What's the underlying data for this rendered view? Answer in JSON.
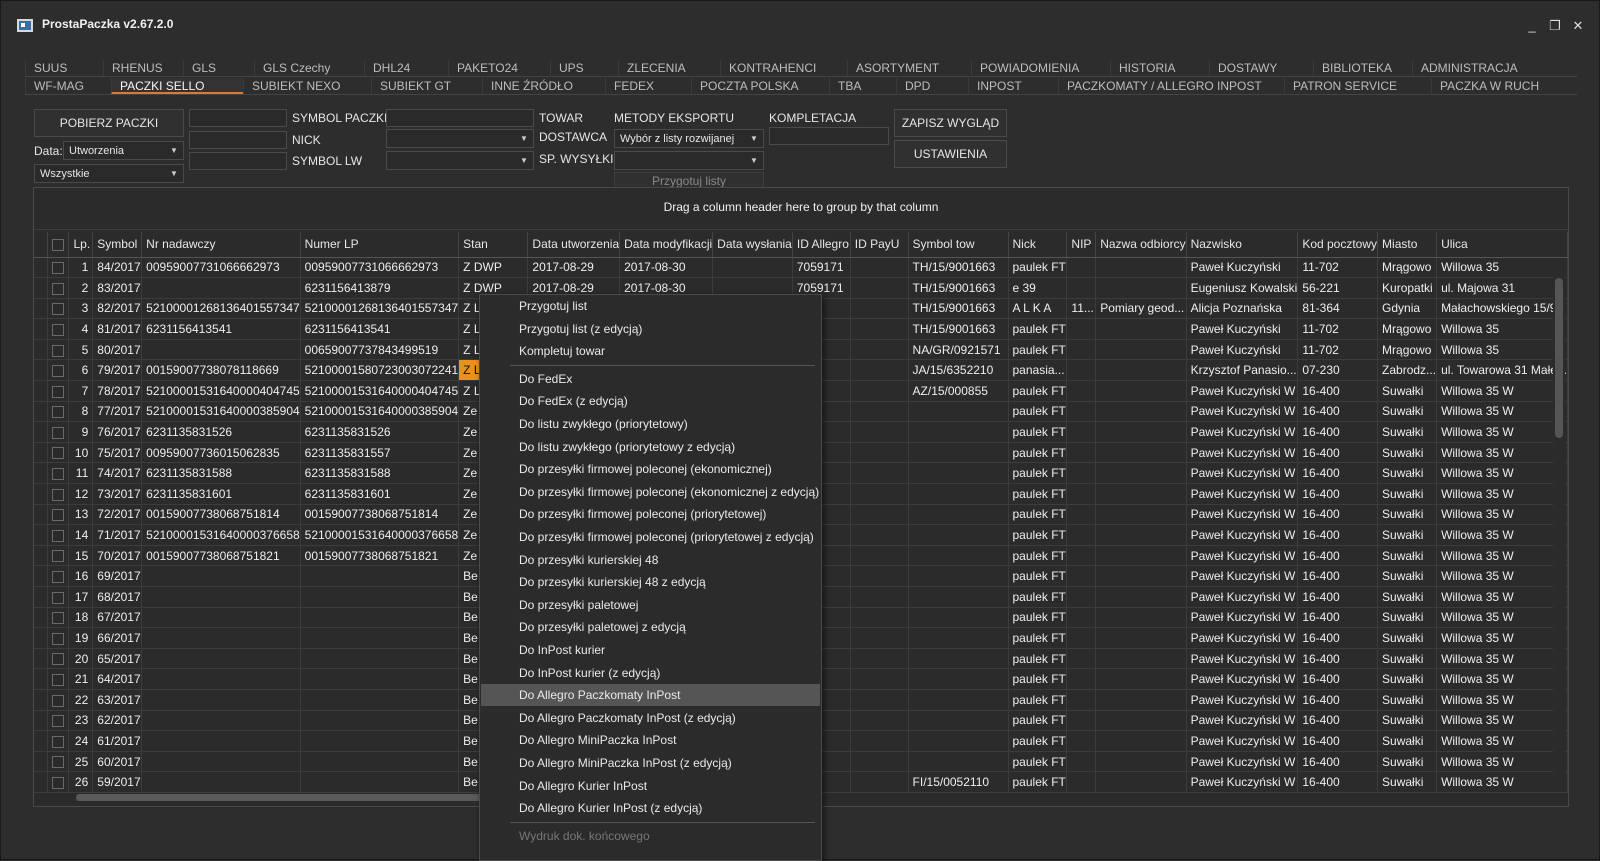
{
  "app": {
    "title": "ProstaPaczka v2.67.2.0",
    "minimize": "_",
    "restore": "❐",
    "close": "✕"
  },
  "tabs_row1": [
    "SUUS",
    "RHENUS",
    "GLS",
    "GLS Czechy",
    "DHL24",
    "PAKETO24",
    "UPS",
    "ZLECENIA",
    "KONTRAHENCI",
    "ASORTYMENT",
    "POWIADOMIENIA",
    "HISTORIA",
    "DOSTAWY",
    "BIBLIOTEKA",
    "ADMINISTRACJA"
  ],
  "tabs_row2": [
    "WF-MAG",
    "PACZKI SELLO",
    "SUBIEKT NEXO",
    "SUBIEKT GT",
    "INNE ŹRÓDŁO",
    "FEDEX",
    "POCZTA POLSKA",
    "TBA",
    "DPD",
    "INPOST",
    "PACZKOMATY / ALLEGRO INPOST",
    "PATRON SERVICE",
    "PACZKA W RUCH"
  ],
  "active_tab2": "PACZKI SELLO",
  "toolbar": {
    "fetch_button": "POBIERZ PACZKI",
    "date_label": "Data:",
    "date_value": "Utworzenia",
    "all_value": "Wszystkie",
    "symbol_label": "SYMBOL PACZKI",
    "nick_label": "NICK",
    "symbol_lw_label": "SYMBOL LW",
    "towar_label": "TOWAR",
    "dostawca_label": "DOSTAWCA",
    "sp_wysylki_label": "SP. WYSYŁKI",
    "export_label": "METODY EKSPORTU",
    "export_value": "Wybór z listy rozwijanej",
    "prepare_lists": "Przygotuj listy",
    "kompletacja_label": "KOMPLETACJA",
    "save_view": "ZAPISZ WYGLĄD",
    "settings": "USTAWIENIA"
  },
  "grid": {
    "group_hint": "Drag a column header here to group by that column",
    "columns": [
      "",
      "",
      "Lp.",
      "Symbol",
      "Nr nadawczy",
      "Numer LP",
      "Stan",
      "Data utworzenia",
      "Data modyfikacji",
      "Data wysłania",
      "ID Allegro",
      "ID PayU",
      "Symbol tow",
      "Nick",
      "NIP",
      "Nazwa odbiorcy",
      "Nazwisko",
      "Kod pocztowy",
      "Miasto",
      "Ulica"
    ],
    "rows": [
      [
        "",
        "",
        "1",
        "84/2017",
        "00959007731066662973",
        "00959007731066662973",
        "Z DWP",
        "2017-08-29",
        "2017-08-30",
        "",
        "7059171",
        "",
        "TH/15/9001663",
        "paulek FT",
        "",
        "",
        "Paweł Kuczyński",
        "11-702",
        "Mrągowo",
        "Willowa 35"
      ],
      [
        "",
        "",
        "2",
        "83/2017",
        "",
        "6231156413879",
        "Z DWP",
        "2017-08-29",
        "2017-08-30",
        "",
        "7059171",
        "",
        "TH/15/9001663",
        "e 39",
        "",
        "",
        "Eugeniusz Kowalski",
        "56-221",
        "Kuropatki",
        "ul. Majowa 31"
      ],
      [
        "",
        "",
        "3",
        "82/2017",
        "52100001268136401557347",
        "52100001268136401557347",
        "Z L",
        "",
        "",
        "",
        "171",
        "",
        "TH/15/9001663",
        "A L K A",
        "11...",
        "Pomiary geod...",
        "Alicja Poznańska",
        "81-364",
        "Gdynia",
        "Małachowskiego 15/98"
      ],
      [
        "",
        "",
        "4",
        "81/2017",
        "6231156413541",
        "6231156413541",
        "Z L",
        "",
        "",
        "",
        "171",
        "",
        "TH/15/9001663",
        "paulek FT",
        "",
        "",
        "Paweł Kuczyński",
        "11-702",
        "Mrągowo",
        "Willowa 35"
      ],
      [
        "",
        "",
        "5",
        "80/2017",
        "",
        "00659007737843499519",
        "Z L",
        "",
        "",
        "",
        "171",
        "",
        "NA/GR/0921571",
        "paulek FT",
        "",
        "",
        "Paweł Kuczyński",
        "11-702",
        "Mrągowo",
        "Willowa 35"
      ],
      [
        "▶",
        "",
        "6",
        "79/2017",
        "00159007738078118669",
        "52100001580723003072241",
        "Z L",
        "",
        "",
        "",
        "171",
        "",
        "JA/15/6352210",
        "panasia...",
        "",
        "",
        "Krzysztof Panasio...",
        "07-230",
        "Zabrodz...",
        "ul. Towarowa 31 Małe..."
      ],
      [
        "",
        "",
        "7",
        "78/2017",
        "52100001531640000404745",
        "52100001531640000404745",
        "Z L",
        "",
        "",
        "",
        "171",
        "",
        "AZ/15/000855",
        "paulek FT",
        "",
        "",
        "Paweł Kuczyński W",
        "16-400",
        "Suwałki",
        "Willowa 35 W"
      ],
      [
        "",
        "",
        "8",
        "77/2017",
        "52100001531640000385904",
        "52100001531640000385904",
        "Ze",
        "",
        "",
        "",
        "171",
        "",
        "",
        "paulek FT",
        "",
        "",
        "Paweł Kuczyński W",
        "16-400",
        "Suwałki",
        "Willowa 35 W"
      ],
      [
        "",
        "",
        "9",
        "76/2017",
        "6231135831526",
        "6231135831526",
        "Ze",
        "",
        "",
        "",
        "171",
        "",
        "",
        "paulek FT",
        "",
        "",
        "Paweł Kuczyński W",
        "16-400",
        "Suwałki",
        "Willowa 35 W"
      ],
      [
        "",
        "",
        "10",
        "75/2017",
        "00959007736015062835",
        "6231135831557",
        "Ze",
        "",
        "",
        "",
        "171",
        "",
        "",
        "paulek FT",
        "",
        "",
        "Paweł Kuczyński W",
        "16-400",
        "Suwałki",
        "Willowa 35 W"
      ],
      [
        "",
        "",
        "11",
        "74/2017",
        "6231135831588",
        "6231135831588",
        "Ze",
        "",
        "",
        "",
        "171",
        "",
        "",
        "paulek FT",
        "",
        "",
        "Paweł Kuczyński W",
        "16-400",
        "Suwałki",
        "Willowa 35 W"
      ],
      [
        "",
        "",
        "12",
        "73/2017",
        "6231135831601",
        "6231135831601",
        "Ze",
        "",
        "",
        "",
        "171",
        "",
        "",
        "paulek FT",
        "",
        "",
        "Paweł Kuczyński W",
        "16-400",
        "Suwałki",
        "Willowa 35 W"
      ],
      [
        "",
        "",
        "13",
        "72/2017",
        "00159007738068751814",
        "00159007738068751814",
        "Ze",
        "",
        "",
        "",
        "171",
        "",
        "",
        "paulek FT",
        "",
        "",
        "Paweł Kuczyński W",
        "16-400",
        "Suwałki",
        "Willowa 35 W"
      ],
      [
        "",
        "",
        "14",
        "71/2017",
        "52100001531640000376658",
        "52100001531640000376658",
        "Ze",
        "",
        "",
        "",
        "171",
        "",
        "",
        "paulek FT",
        "",
        "",
        "Paweł Kuczyński W",
        "16-400",
        "Suwałki",
        "Willowa 35 W"
      ],
      [
        "",
        "",
        "15",
        "70/2017",
        "00159007738068751821",
        "00159007738068751821",
        "Ze",
        "",
        "",
        "",
        "171",
        "",
        "",
        "paulek FT",
        "",
        "",
        "Paweł Kuczyński W",
        "16-400",
        "Suwałki",
        "Willowa 35 W"
      ],
      [
        "",
        "",
        "16",
        "69/2017",
        "",
        "",
        "Be",
        "",
        "",
        "",
        "171",
        "",
        "",
        "paulek FT",
        "",
        "",
        "Paweł Kuczyński W",
        "16-400",
        "Suwałki",
        "Willowa 35 W"
      ],
      [
        "",
        "",
        "17",
        "68/2017",
        "",
        "",
        "Be",
        "",
        "",
        "",
        "171",
        "",
        "",
        "paulek FT",
        "",
        "",
        "Paweł Kuczyński W",
        "16-400",
        "Suwałki",
        "Willowa 35 W"
      ],
      [
        "",
        "",
        "18",
        "67/2017",
        "",
        "",
        "Be",
        "",
        "",
        "",
        "171",
        "",
        "",
        "paulek FT",
        "",
        "",
        "Paweł Kuczyński W",
        "16-400",
        "Suwałki",
        "Willowa 35 W"
      ],
      [
        "",
        "",
        "19",
        "66/2017",
        "",
        "",
        "Be",
        "",
        "",
        "",
        "171",
        "",
        "",
        "paulek FT",
        "",
        "",
        "Paweł Kuczyński W",
        "16-400",
        "Suwałki",
        "Willowa 35 W"
      ],
      [
        "",
        "",
        "20",
        "65/2017",
        "",
        "",
        "Be",
        "",
        "",
        "",
        "171",
        "",
        "",
        "paulek FT",
        "",
        "",
        "Paweł Kuczyński W",
        "16-400",
        "Suwałki",
        "Willowa 35 W"
      ],
      [
        "",
        "",
        "21",
        "64/2017",
        "",
        "",
        "Be",
        "",
        "",
        "",
        "171",
        "",
        "",
        "paulek FT",
        "",
        "",
        "Paweł Kuczyński W",
        "16-400",
        "Suwałki",
        "Willowa 35 W"
      ],
      [
        "",
        "",
        "22",
        "63/2017",
        "",
        "",
        "Be",
        "",
        "",
        "",
        "171",
        "",
        "",
        "paulek FT",
        "",
        "",
        "Paweł Kuczyński W",
        "16-400",
        "Suwałki",
        "Willowa 35 W"
      ],
      [
        "",
        "",
        "23",
        "62/2017",
        "",
        "",
        "Be",
        "",
        "",
        "",
        "171",
        "",
        "",
        "paulek FT",
        "",
        "",
        "Paweł Kuczyński W",
        "16-400",
        "Suwałki",
        "Willowa 35 W"
      ],
      [
        "",
        "",
        "24",
        "61/2017",
        "",
        "",
        "Be",
        "",
        "",
        "",
        "171",
        "",
        "",
        "paulek FT",
        "",
        "",
        "Paweł Kuczyński W",
        "16-400",
        "Suwałki",
        "Willowa 35 W"
      ],
      [
        "",
        "",
        "25",
        "60/2017",
        "",
        "",
        "Be",
        "",
        "",
        "",
        "171",
        "",
        "",
        "paulek FT",
        "",
        "",
        "Paweł Kuczyński W",
        "16-400",
        "Suwałki",
        "Willowa 35 W"
      ],
      [
        "",
        "",
        "26",
        "59/2017",
        "",
        "",
        "Be",
        "",
        "",
        "",
        "171",
        "",
        "FI/15/0052110",
        "paulek FT",
        "",
        "",
        "Paweł Kuczyński W",
        "16-400",
        "Suwałki",
        "Willowa 35 W"
      ]
    ],
    "highlight_state_color": "#e8921e"
  },
  "context_menu": [
    {
      "label": "Przygotuj list"
    },
    {
      "label": "Przygotuj list (z edycją)"
    },
    {
      "label": "Kompletuj towar"
    },
    {
      "sep": true
    },
    {
      "label": "Do FedEx"
    },
    {
      "label": "Do FedEx (z edycją)"
    },
    {
      "label": "Do listu zwykłego (priorytetowy)"
    },
    {
      "label": "Do listu zwykłego (priorytetowy z edycją)"
    },
    {
      "label": "Do przesyłki firmowej poleconej (ekonomicznej)"
    },
    {
      "label": "Do przesyłki firmowej poleconej (ekonomicznej z edycją)"
    },
    {
      "label": "Do przesyłki firmowej poleconej (priorytetowej)"
    },
    {
      "label": "Do przesyłki firmowej poleconej (priorytetowej z edycją)"
    },
    {
      "label": "Do przesyłki kurierskiej 48"
    },
    {
      "label": "Do przesyłki kurierskiej 48 z edycją"
    },
    {
      "label": "Do przesyłki paletowej"
    },
    {
      "label": "Do przesyłki paletowej z edycją"
    },
    {
      "label": "Do InPost kurier"
    },
    {
      "label": "Do InPost kurier (z edycją)"
    },
    {
      "label": "Do Allegro Paczkomaty InPost",
      "selected": true
    },
    {
      "label": "Do Allegro Paczkomaty InPost (z edycją)"
    },
    {
      "label": "Do Allegro MiniPaczka InPost"
    },
    {
      "label": "Do Allegro MiniPaczka InPost (z edycją)"
    },
    {
      "label": "Do Allegro Kurier InPost"
    },
    {
      "label": "Do Allegro Kurier InPost (z edycją)"
    },
    {
      "sep": true
    },
    {
      "label": "Wydruk dok. końcowego",
      "disabled": true
    }
  ]
}
